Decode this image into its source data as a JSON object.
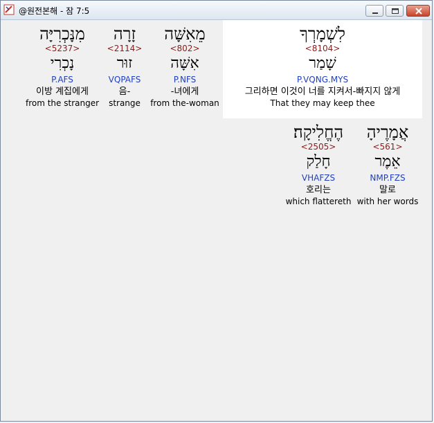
{
  "window": {
    "title": "@원전본해 - 잠 7:5"
  },
  "words": [
    {
      "hebrew": "לִשְׁמָרְךָ",
      "strong": "<8104>",
      "lemma": "שָׁמַר",
      "morph": "P.VQNG.MYS",
      "korean": "그리하면 이것이 너를 지켜서-빠지지 않게",
      "english": "That they may keep thee"
    },
    {
      "hebrew": "מֵאִשָּׁה",
      "strong": "<802>",
      "lemma": "אִשָּׁה",
      "morph": "P.NFS",
      "korean": "-녀에게",
      "english": "from the-woman"
    },
    {
      "hebrew": "זָרָה",
      "strong": "<2114>",
      "lemma": "זוּר",
      "morph": "VQPAFS",
      "korean": "음-",
      "english": "strange"
    },
    {
      "hebrew": "מִנָּכְרִיָּה",
      "strong": "<5237>",
      "lemma": "נָכְרִי",
      "morph": "P.AFS",
      "korean": "이방 계집에게",
      "english": "from the stranger"
    },
    {
      "hebrew": "אֲמָרֶיהָ",
      "strong": "<561>",
      "lemma": "אֵמֶר",
      "morph": "NMP.FZS",
      "korean": "말로",
      "english": "with her words"
    },
    {
      "hebrew": "הֶחֱלִיקָה׃",
      "strong": "<2505>",
      "lemma": "חָלַק",
      "morph": "VHAFZS",
      "korean": "호리는",
      "english": "which flattereth"
    }
  ]
}
